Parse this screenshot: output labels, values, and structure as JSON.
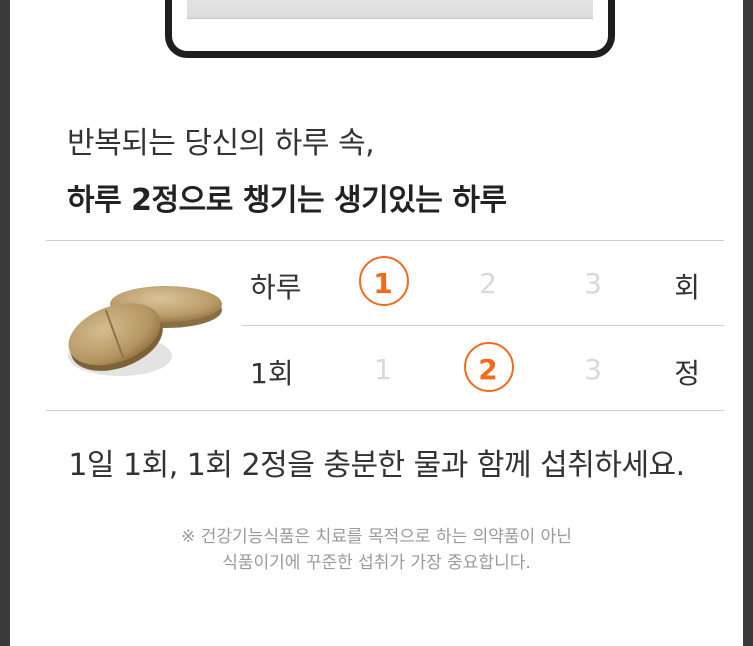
{
  "headline": {
    "line1": "반복되는 당신의 하루 속,",
    "line2": "하루 2정으로 챙기는 생기있는 하루"
  },
  "dosage_table": {
    "rows": [
      {
        "label": "하루",
        "options": [
          "1",
          "2",
          "3"
        ],
        "selected": "1",
        "unit": "회"
      },
      {
        "label": "1회",
        "options": [
          "1",
          "2",
          "3"
        ],
        "selected": "2",
        "unit": "정"
      }
    ]
  },
  "instruction": "1일 1회, 1회 2정을 충분한 물과 함께 섭취하세요.",
  "notice": {
    "line1": "※ 건강기능식품은 치료를 목적으로 하는 의약품이 아닌",
    "line2": "식품이기에 꾸준한 섭취가 가장 중요합니다."
  },
  "colors": {
    "accent": "#f26b1d",
    "text": "#333333",
    "muted": "#d9d9d9",
    "frame": "#3a3a3a"
  },
  "icons": {
    "clipboard": "clipboard-clip-icon",
    "tablet": "tablet-pills-image"
  }
}
